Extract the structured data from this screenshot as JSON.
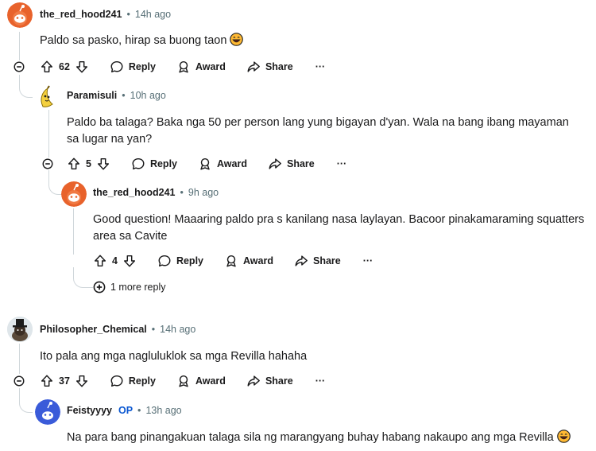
{
  "comments": [
    {
      "username": "the_red_hood241",
      "time": "14h ago",
      "text": "Paldo sa pasko, hirap sa buong taon",
      "votes": "62"
    },
    {
      "username": "Paramisuli",
      "time": "10h ago",
      "text": "Paldo ba talaga? Baka nga 50 per person lang yung bigayan d'yan. Wala na bang ibang mayaman sa lugar na yan?",
      "votes": "5"
    },
    {
      "username": "the_red_hood241",
      "time": "9h ago",
      "text": "Good question! Maaaring paldo pra s kanilang nasa laylayan. Bacoor pinakamaraming squatters area sa Cavite",
      "votes": "4"
    },
    {
      "username": "Philosopher_Chemical",
      "time": "14h ago",
      "text": "Ito pala ang mga nagluluklok sa mga Revilla hahaha",
      "votes": "37"
    },
    {
      "username": "Feistyyyy",
      "op_badge": "OP",
      "time": "13h ago",
      "text": "Na para bang pinangakuan talaga sila ng marangyang buhay habang nakaupo ang mga Revilla"
    }
  ],
  "labels": {
    "reply": "Reply",
    "award": "Award",
    "share": "Share",
    "more": "···",
    "separator": "•"
  },
  "more_replies": "1 more reply",
  "icons": {
    "upvote": "arrow-up-icon",
    "downvote": "arrow-down-icon",
    "reply": "speech-bubble-icon",
    "award": "award-icon",
    "share": "share-arrow-icon",
    "collapse": "minus-circle-icon",
    "expand": "plus-circle-icon",
    "emoji": "grinning-emoji-icon"
  },
  "colors": {
    "snoo_orange": "#e8622b",
    "op_blue": "#0a57d1",
    "meta_gray": "#576f76",
    "thread_line": "#d0d7db"
  }
}
